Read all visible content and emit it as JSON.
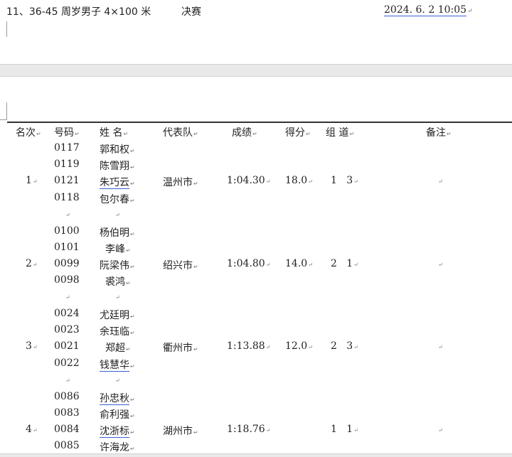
{
  "header": {
    "event": "11、36-45 周岁男子 4×100 米",
    "stage": "决赛",
    "datetime": "2024. 6. 2  10:05"
  },
  "columns": [
    "名次",
    "号码",
    "姓  名",
    "代表队",
    "成绩",
    "得分",
    "组  道",
    "备注"
  ],
  "rows": [
    {
      "rank": "1",
      "team": "温州市",
      "result": "1:04.30",
      "score": "18.0",
      "group": "1",
      "lane": "3",
      "members": [
        {
          "bib": "0117",
          "name": "郭和权"
        },
        {
          "bib": "0119",
          "name": "陈雪翔"
        },
        {
          "bib": "0121",
          "name": "朱巧云"
        },
        {
          "bib": "0118",
          "name": "包尔春"
        }
      ]
    },
    {
      "rank": "2",
      "team": "绍兴市",
      "result": "1:04.80",
      "score": "14.0",
      "group": "2",
      "lane": "1",
      "members": [
        {
          "bib": "0100",
          "name": "杨伯明"
        },
        {
          "bib": "0101",
          "name": "李峰"
        },
        {
          "bib": "0099",
          "name": "阮梁伟"
        },
        {
          "bib": "0098",
          "name": "裘鸿"
        }
      ]
    },
    {
      "rank": "3",
      "team": "衢州市",
      "result": "1:13.88",
      "score": "12.0",
      "group": "2",
      "lane": "3",
      "members": [
        {
          "bib": "0024",
          "name": "尤廷明"
        },
        {
          "bib": "0023",
          "name": "余珏临"
        },
        {
          "bib": "0021",
          "name": "郑超"
        },
        {
          "bib": "0022",
          "name": "钱慧华"
        }
      ]
    },
    {
      "rank": "4",
      "team": "湖州市",
      "result": "1:18.76",
      "score": "",
      "group": "1",
      "lane": "1",
      "members": [
        {
          "bib": "0086",
          "name": "孙忠秋"
        },
        {
          "bib": "0083",
          "name": "俞利强"
        },
        {
          "bib": "0084",
          "name": "沈浙标"
        },
        {
          "bib": "0085",
          "name": "许海龙"
        }
      ]
    }
  ]
}
